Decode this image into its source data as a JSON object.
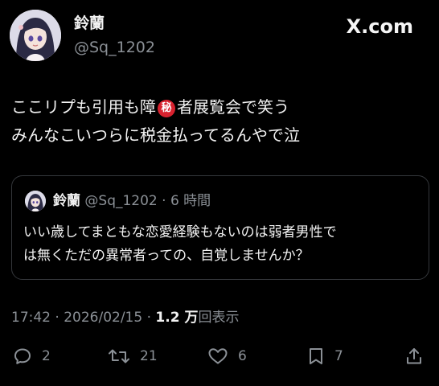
{
  "tweet": {
    "author": {
      "display_name": "鈴蘭",
      "handle": "@Sq_1202"
    },
    "brand": "X.com",
    "text_lines": {
      "line1_before": "ここリプも引用も障",
      "secret_mark": "秘",
      "line1_after": "者展覧会で笑う",
      "line2": "みんなこいつらに税金払ってるんやで泣"
    },
    "quote": {
      "display_name": "鈴蘭",
      "meta": "@Sq_1202 · 6 時間",
      "text_lines": [
        "いい歳してまともな恋愛経験もないのは弱者男性で",
        "は無くただの異常者っての、自覚しませんか？"
      ]
    },
    "meta": {
      "timestamp": "17:42 · 2026/02/15 · ",
      "views_count": "1.2 万",
      "views_label": "回表示"
    },
    "actions": {
      "replies": "2",
      "retweets": "21",
      "likes": "6",
      "bookmarks": "7"
    }
  },
  "icons": [
    "reply-icon",
    "retweet-icon",
    "like-icon",
    "bookmark-icon",
    "share-icon"
  ],
  "colors": {
    "background": "#000000",
    "text": "#f2f2f2",
    "muted": "#8b9096",
    "badge_red": "#d8222f",
    "border": "#34373b"
  }
}
